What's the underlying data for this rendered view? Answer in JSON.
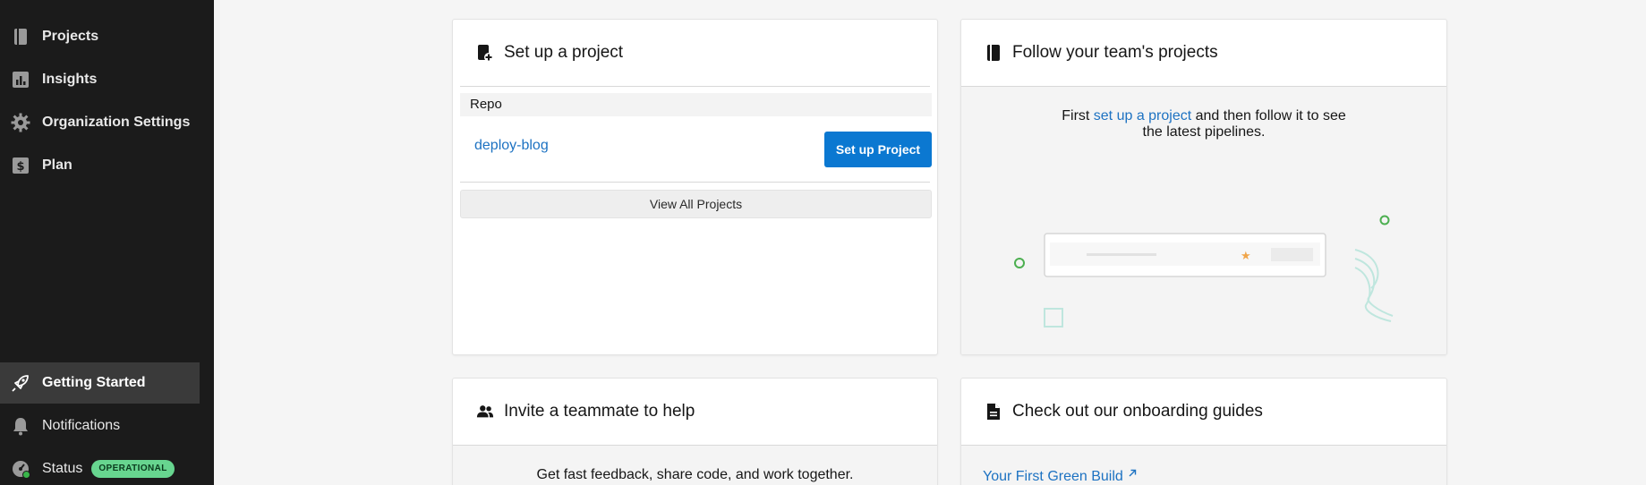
{
  "sidebar": {
    "items": [
      {
        "label": "Projects",
        "icon": "book-icon"
      },
      {
        "label": "Insights",
        "icon": "bar-chart-icon"
      },
      {
        "label": "Organization Settings",
        "icon": "gear-icon"
      },
      {
        "label": "Plan",
        "icon": "dollar-icon"
      }
    ],
    "bottom_items": [
      {
        "label": "Getting Started",
        "icon": "rocket-icon",
        "active": true
      },
      {
        "label": "Notifications",
        "icon": "bell-icon"
      },
      {
        "label": "Status",
        "icon": "gauge-icon",
        "badge": "OPERATIONAL"
      }
    ]
  },
  "setup_card": {
    "title": "Set up a project",
    "table_header": "Repo",
    "repo_name": "deploy-blog",
    "setup_button": "Set up Project",
    "view_all": "View All Projects"
  },
  "follow_card": {
    "title": "Follow your team's projects",
    "text_before": "First ",
    "link": "set up a project",
    "text_after": " and then follow it to see",
    "text_line2": "the latest pipelines."
  },
  "invite_card": {
    "title": "Invite a teammate to help",
    "text": "Get fast feedback, share code, and work together."
  },
  "guides_card": {
    "title": "Check out our onboarding guides",
    "link": "Your First Green Build"
  },
  "colors": {
    "sidebar_bg": "#1b1b1b",
    "link": "#1d72c2",
    "primary_button": "#0b78d1",
    "badge": "#67d58f",
    "illustration_green": "#4caf50",
    "illustration_teal": "#bfe6de",
    "illustration_star": "#f0a54a"
  }
}
